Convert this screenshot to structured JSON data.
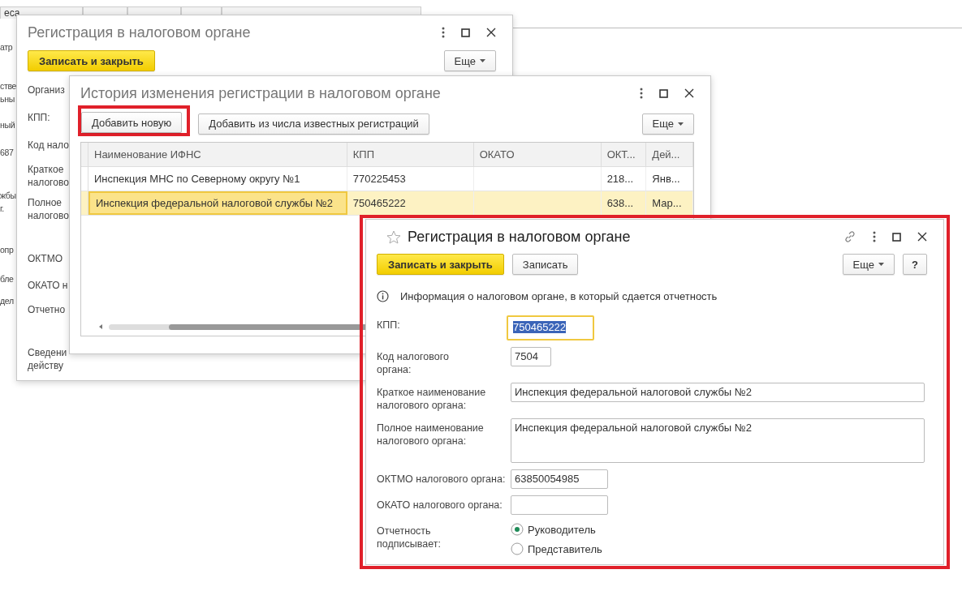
{
  "background_window": {
    "tab_label": "еса",
    "fragments": [
      "атр",
      "стве",
      "ьны",
      "ный",
      "687",
      "жбы",
      "г.",
      "опр",
      "бле",
      "дел"
    ]
  },
  "registration_window_back": {
    "title": "Регистрация в налоговом органе",
    "save_close_button": "Записать и закрыть",
    "more_button": "Еще",
    "labels": [
      [
        "Организ"
      ],
      [
        "КПП:"
      ],
      [
        "Код нало"
      ],
      [
        "Краткое",
        "налогово"
      ],
      [
        "Полное",
        "налогово"
      ],
      [
        "ОКТМО"
      ],
      [
        "ОКАТО н"
      ],
      [
        "Отчетно"
      ],
      [
        "Сведени",
        "действу"
      ]
    ]
  },
  "history_window": {
    "title": "История изменения регистрации в налоговом органе",
    "buttons": [
      {
        "label": "Добавить новую",
        "highlighted": true
      },
      {
        "label": "Добавить из числа известных регистраций",
        "highlighted": false
      }
    ],
    "more_button": "Еще",
    "columns": [
      "Наименование ИФНС",
      "КПП",
      "ОКАТО",
      "ОКТ...",
      "Дей..."
    ],
    "rows": [
      {
        "cells": [
          "Инспекция МНС по Северному округу №1",
          "770225453",
          "",
          "218...",
          "Янв..."
        ],
        "selected": false
      },
      {
        "cells": [
          "Инспекция федеральной налоговой службы №2",
          "750465222",
          "",
          "638...",
          "Мар..."
        ],
        "selected": true
      }
    ]
  },
  "registration_window": {
    "highlighted": true,
    "title": "Регистрация в налоговом органе",
    "save_close_button": "Записать и закрыть",
    "save_button": "Записать",
    "more_button": "Еще",
    "help_button": "?",
    "info": "Информация о налоговом органе, в который сдается отчетность",
    "fields": [
      {
        "label": [
          "КПП:"
        ],
        "value": "750465222",
        "kind": "short",
        "focused": true
      },
      {
        "label": [
          "Код налогового",
          "органа:"
        ],
        "value": "7504",
        "kind": "tiny",
        "focused": false
      },
      {
        "label": [
          "Краткое наименование",
          "налогового органа:"
        ],
        "value": "Инспекция федеральной налоговой службы №2",
        "kind": "wide",
        "focused": false
      },
      {
        "label": [
          "Полное наименование",
          "налогового органа:"
        ],
        "value": "Инспекция федеральной налоговой службы №2",
        "kind": "area",
        "focused": false
      },
      {
        "label": [
          "ОКТМО налогового органа:"
        ],
        "value": "63850054985",
        "kind": "short",
        "focused": false
      },
      {
        "label": [
          "ОКАТО налогового органа:"
        ],
        "kind": "short",
        "focused": false
      }
    ],
    "signer_label": [
      "Отчетность",
      "подписывает:"
    ],
    "signer_options": [
      {
        "label": "Руководитель",
        "selected": true
      },
      {
        "label": "Представитель",
        "selected": false
      }
    ]
  }
}
